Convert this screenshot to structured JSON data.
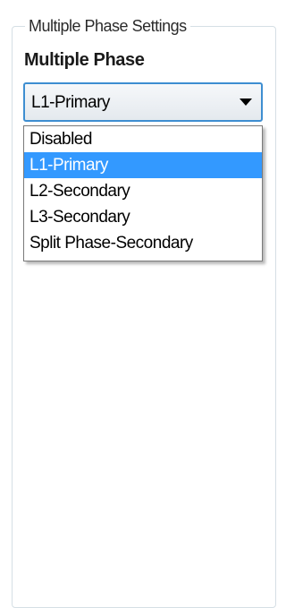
{
  "group": {
    "title": "Multiple Phase Settings"
  },
  "field": {
    "label": "Multiple Phase",
    "selected_value": "L1-Primary"
  },
  "dropdown": {
    "options": [
      {
        "label": "Disabled",
        "selected": false
      },
      {
        "label": "L1-Primary",
        "selected": true
      },
      {
        "label": "L2-Secondary",
        "selected": false
      },
      {
        "label": "L3-Secondary",
        "selected": false
      },
      {
        "label": "Split Phase-Secondary",
        "selected": false
      }
    ]
  },
  "colors": {
    "selection_highlight": "#3399ff",
    "combo_focus_border": "#3e8ed1",
    "group_border": "#d5dfe5"
  }
}
